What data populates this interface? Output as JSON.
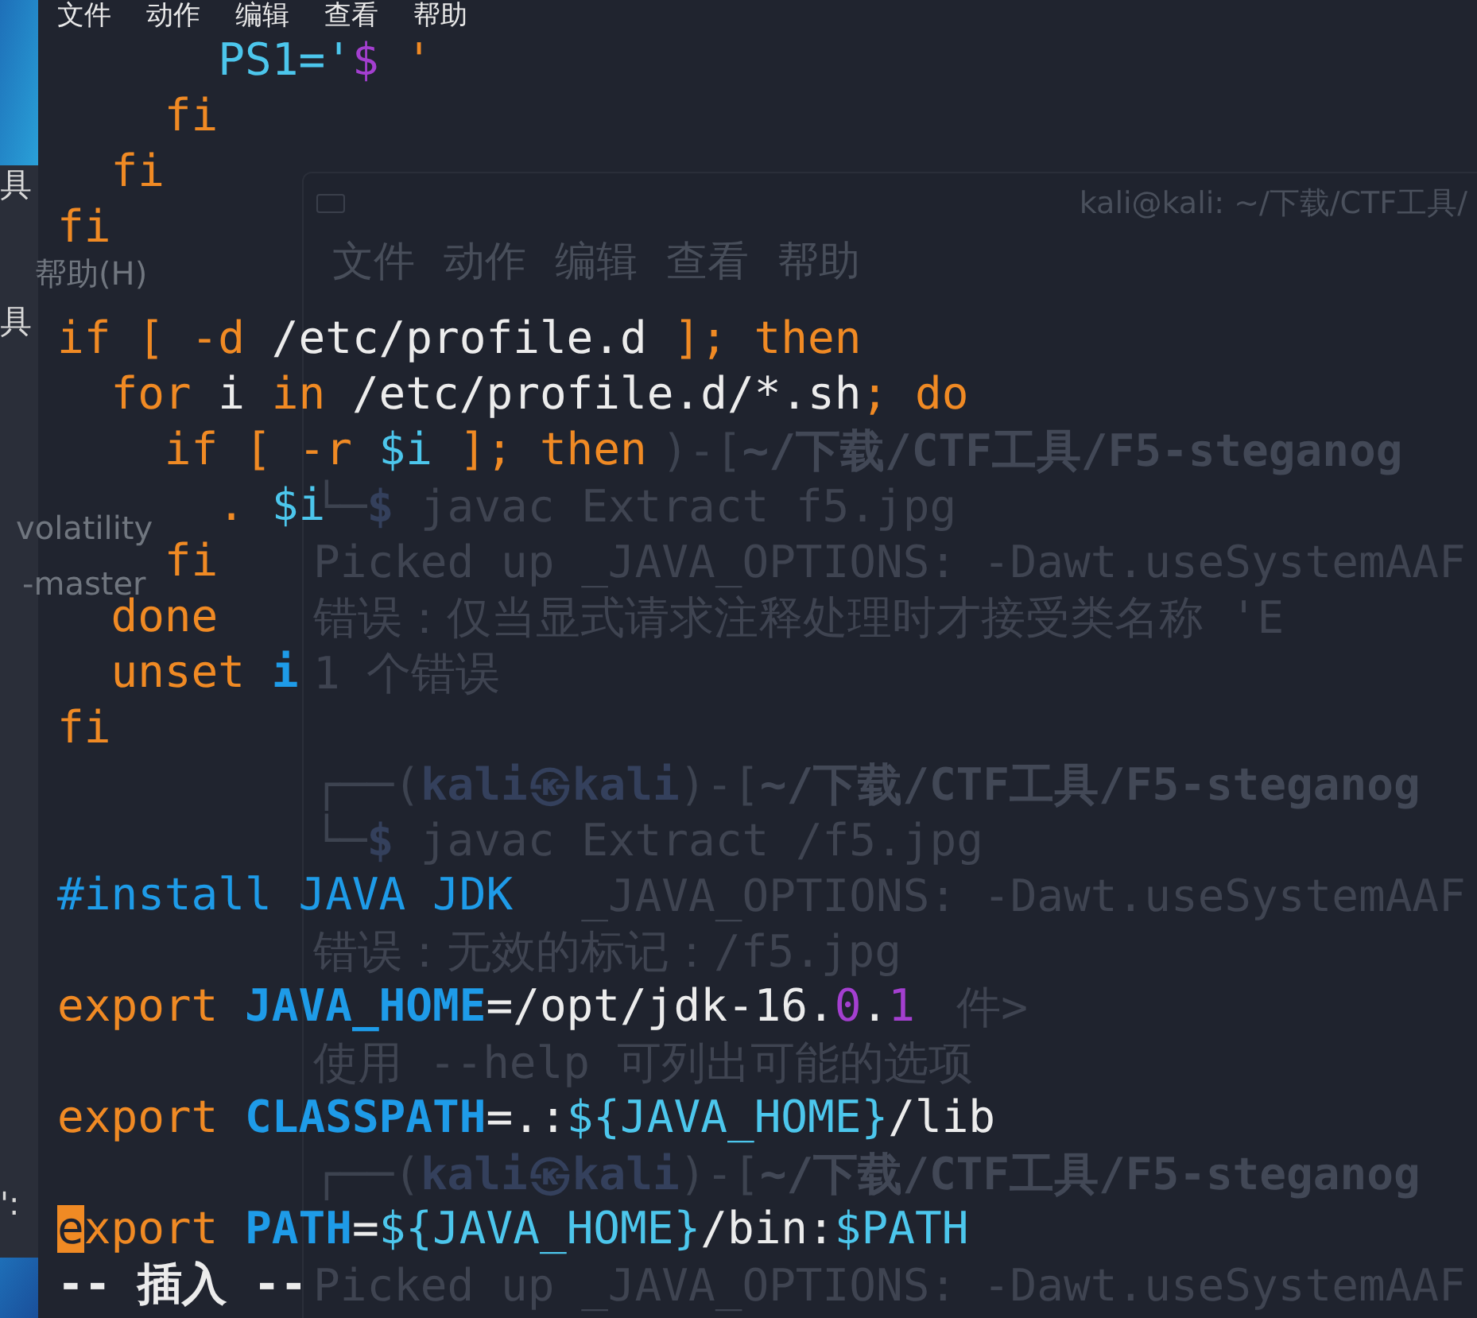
{
  "file_manager": {
    "items": [
      {
        "text": "具",
        "kind": "cut"
      },
      {
        "text": "帮助(H)",
        "kind": "faint"
      },
      {
        "text": "具",
        "kind": "cut"
      },
      {
        "text": "volatility",
        "kind": "faint"
      },
      {
        "text": "-master",
        "kind": "faint"
      },
      {
        "text": "':",
        "kind": "cut"
      }
    ]
  },
  "back_terminal": {
    "title": "kali@kali: ~/下载/CTF工具/",
    "menu": [
      "文件",
      "动作",
      "编辑",
      "查看",
      "帮助"
    ],
    "lines": [
      [
        {
          "text": ")-[",
          "kind": "frame"
        },
        {
          "text": "~/下载/CTF工具/F5-steganog",
          "kind": "path"
        }
      ],
      [
        {
          "text": "└─",
          "kind": "frame"
        },
        {
          "text": "$",
          "kind": "user"
        },
        {
          "text": " javac Extract f5.jpg",
          "kind": "plain"
        }
      ],
      [
        {
          "text": "Picked up _JAVA_OPTIONS: -Dawt.useSystemAAF",
          "kind": "plain"
        }
      ],
      [
        {
          "text": "错误：仅当显式请求注释处理时才接受类名称 'E",
          "kind": "plain"
        }
      ],
      [
        {
          "text": "1 个错误",
          "kind": "plain"
        }
      ],
      [
        {
          "text": "┌──(",
          "kind": "frame"
        },
        {
          "text": "kali㉿kali",
          "kind": "user"
        },
        {
          "text": ")-[",
          "kind": "frame"
        },
        {
          "text": "~/下载/CTF工具/F5-steganog",
          "kind": "path"
        }
      ],
      [
        {
          "text": "└─",
          "kind": "frame"
        },
        {
          "text": "$",
          "kind": "user"
        },
        {
          "text": " javac Extract /f5.jpg",
          "kind": "plain"
        }
      ],
      [
        {
          "text": "_JAVA_OPTIONS: -Dawt.useSystemAAF",
          "kind": "plain"
        }
      ],
      [
        {
          "text": "错误：无效的标记：/f5.jpg",
          "kind": "plain"
        }
      ],
      [
        {
          "text": "件>",
          "kind": "plain"
        }
      ],
      [
        {
          "text": "使用 --help 可列出可能的选项",
          "kind": "plain"
        }
      ],
      [
        {
          "text": "┌──(",
          "kind": "frame"
        },
        {
          "text": "kali㉿kali",
          "kind": "user"
        },
        {
          "text": ")-[",
          "kind": "frame"
        },
        {
          "text": "~/下载/CTF工具/F5-steganog",
          "kind": "path"
        }
      ],
      [
        {
          "text": "Picked up _JAVA_OPTIONS: -Dawt.useSystemAAF",
          "kind": "plain"
        }
      ]
    ]
  },
  "editor": {
    "menu": [
      "文件",
      "动作",
      "编辑",
      "查看",
      "帮助"
    ],
    "lines": [
      {
        "kind": "code",
        "segments": [
          {
            "text": "      PS1='",
            "kind": "var"
          },
          {
            "text": "$",
            "kind": "special"
          },
          {
            "text": " '",
            "kind": "keyword"
          }
        ]
      },
      {
        "kind": "code",
        "segments": [
          {
            "text": "    fi",
            "kind": "keyword"
          }
        ]
      },
      {
        "kind": "code",
        "segments": [
          {
            "text": "  fi",
            "kind": "keyword"
          }
        ]
      },
      {
        "kind": "code",
        "segments": [
          {
            "text": "fi",
            "kind": "keyword"
          }
        ]
      },
      {
        "kind": "blank"
      },
      {
        "kind": "code",
        "segments": [
          {
            "text": "if [ -d",
            "kind": "keyword"
          },
          {
            "text": " /etc/profile.d ",
            "kind": "plain"
          },
          {
            "text": "]; then",
            "kind": "keyword"
          }
        ]
      },
      {
        "kind": "code",
        "segments": [
          {
            "text": "  for",
            "kind": "keyword"
          },
          {
            "text": " i ",
            "kind": "plain"
          },
          {
            "text": "in",
            "kind": "keyword"
          },
          {
            "text": " /etc/profile.d/*.sh",
            "kind": "plain"
          },
          {
            "text": "; do",
            "kind": "keyword"
          }
        ]
      },
      {
        "kind": "code",
        "segments": [
          {
            "text": "    if [ -r ",
            "kind": "keyword"
          },
          {
            "text": "$i",
            "kind": "var"
          },
          {
            "text": " ]; then",
            "kind": "keyword"
          }
        ]
      },
      {
        "kind": "code",
        "segments": [
          {
            "text": "      . ",
            "kind": "keyword"
          },
          {
            "text": "$i",
            "kind": "var"
          }
        ]
      },
      {
        "kind": "code",
        "segments": [
          {
            "text": "    fi",
            "kind": "keyword"
          }
        ]
      },
      {
        "kind": "code",
        "segments": [
          {
            "text": "  done",
            "kind": "keyword"
          }
        ]
      },
      {
        "kind": "code",
        "segments": [
          {
            "text": "  unset ",
            "kind": "keyword"
          },
          {
            "text": "i",
            "kind": "ident"
          }
        ]
      },
      {
        "kind": "code",
        "segments": [
          {
            "text": "fi",
            "kind": "keyword"
          }
        ]
      },
      {
        "kind": "blank"
      },
      {
        "kind": "blank"
      },
      {
        "kind": "code",
        "segments": [
          {
            "text": "#install JAVA JDK",
            "kind": "comment"
          }
        ]
      },
      {
        "kind": "blank"
      },
      {
        "kind": "code",
        "segments": [
          {
            "text": "export ",
            "kind": "keyword"
          },
          {
            "text": "JAVA_HOME",
            "kind": "ident"
          },
          {
            "text": "=/opt/jdk-16.",
            "kind": "plain"
          },
          {
            "text": "0",
            "kind": "special"
          },
          {
            "text": ".",
            "kind": "plain"
          },
          {
            "text": "1",
            "kind": "special"
          }
        ]
      },
      {
        "kind": "blank"
      },
      {
        "kind": "code",
        "segments": [
          {
            "text": "export ",
            "kind": "keyword"
          },
          {
            "text": "CLASSPATH",
            "kind": "ident"
          },
          {
            "text": "=.:",
            "kind": "plain"
          },
          {
            "text": "${JAVA_HOME}",
            "kind": "var"
          },
          {
            "text": "/lib",
            "kind": "plain"
          }
        ]
      },
      {
        "kind": "blank"
      },
      {
        "kind": "code",
        "segments": [
          {
            "text": "e",
            "kind": "cursor"
          },
          {
            "text": "xport ",
            "kind": "keyword"
          },
          {
            "text": "PATH",
            "kind": "ident"
          },
          {
            "text": "=",
            "kind": "plain"
          },
          {
            "text": "${JAVA_HOME}",
            "kind": "var"
          },
          {
            "text": "/bin:",
            "kind": "plain"
          },
          {
            "text": "$PATH",
            "kind": "var"
          }
        ]
      }
    ],
    "mode": "-- 插入 --"
  }
}
